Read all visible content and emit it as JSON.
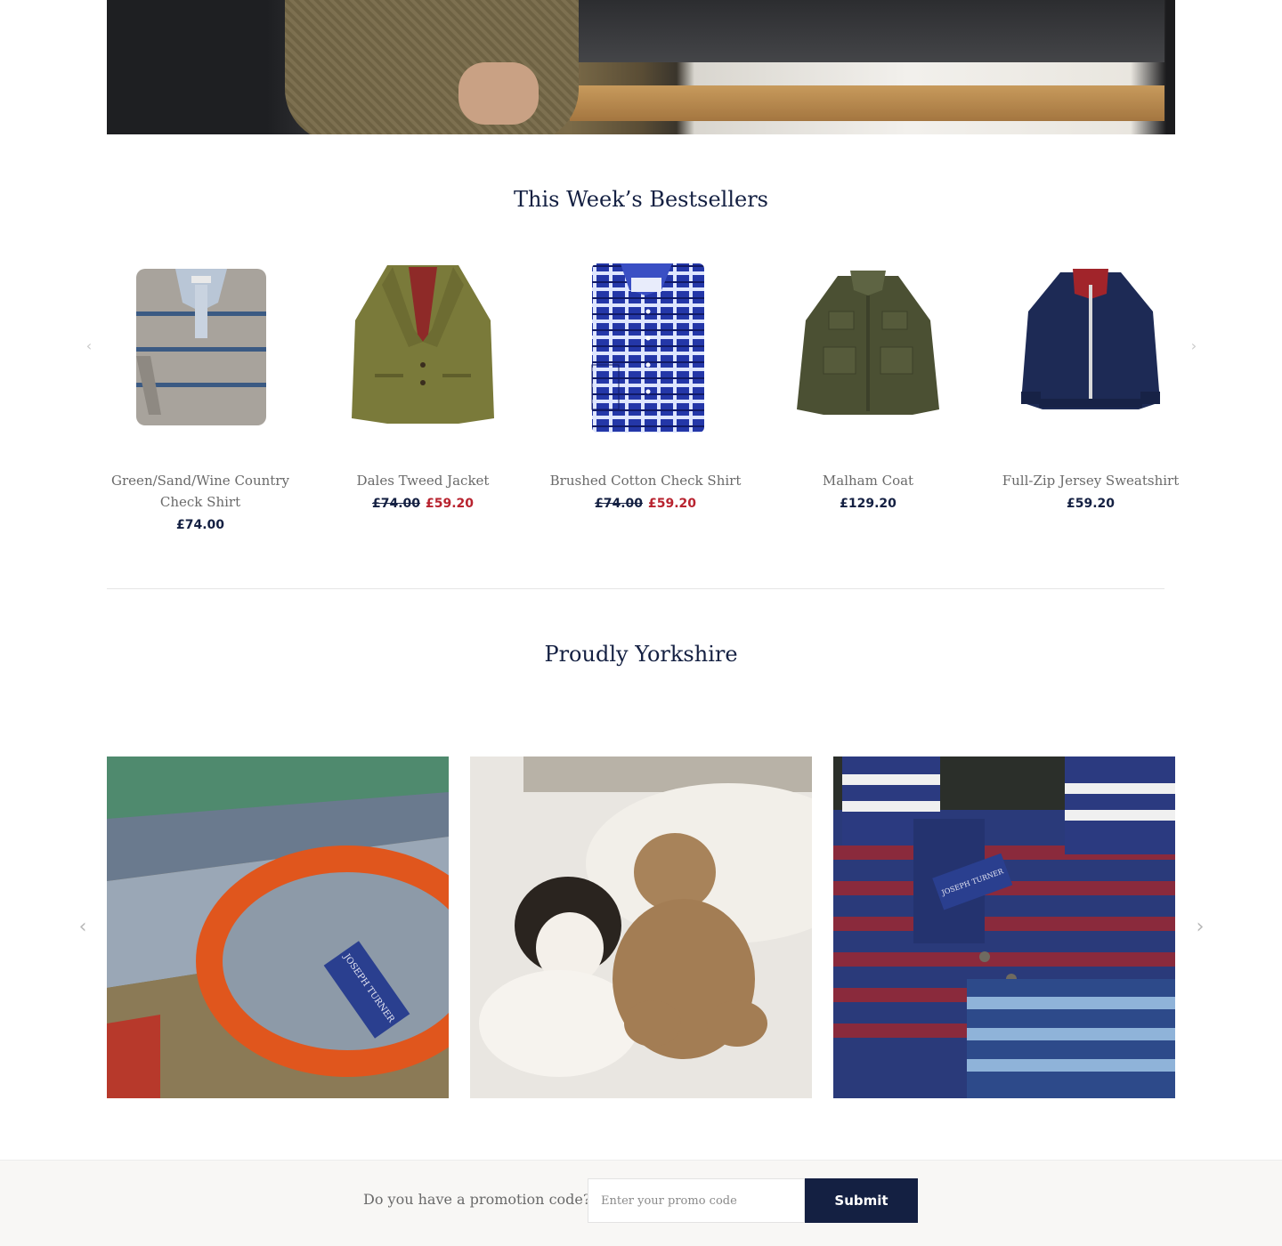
{
  "bestsellers": {
    "title": "This Week’s Bestsellers",
    "prev_icon": "chevron-left-icon",
    "next_icon": "chevron-right-icon",
    "prev_glyph": "‹",
    "next_glyph": "›",
    "products": [
      {
        "name": "Green/Sand/Wine Country Check Shirt",
        "price": "£74.00",
        "old_price": "",
        "sale_price": ""
      },
      {
        "name": "Dales Tweed Jacket",
        "price": "",
        "old_price": "£74.00",
        "sale_price": "£59.20"
      },
      {
        "name": "Brushed Cotton Check Shirt",
        "price": "",
        "old_price": "£74.00",
        "sale_price": "£59.20"
      },
      {
        "name": "Malham Coat",
        "price": "£129.20",
        "old_price": "",
        "sale_price": ""
      },
      {
        "name": "Full-Zip Jersey Sweatshirt",
        "price": "£59.20",
        "old_price": "",
        "sale_price": ""
      }
    ]
  },
  "yorkshire": {
    "title": "Proudly Yorkshire",
    "prev_glyph": "‹",
    "next_glyph": "›",
    "label_text": "JOSEPH TURNER"
  },
  "promo": {
    "label": "Do you have a promotion code?",
    "placeholder": "Enter your promo code",
    "submit_label": "Submit"
  },
  "colors": {
    "navy": "#142042",
    "sale_red": "#b8232f"
  }
}
